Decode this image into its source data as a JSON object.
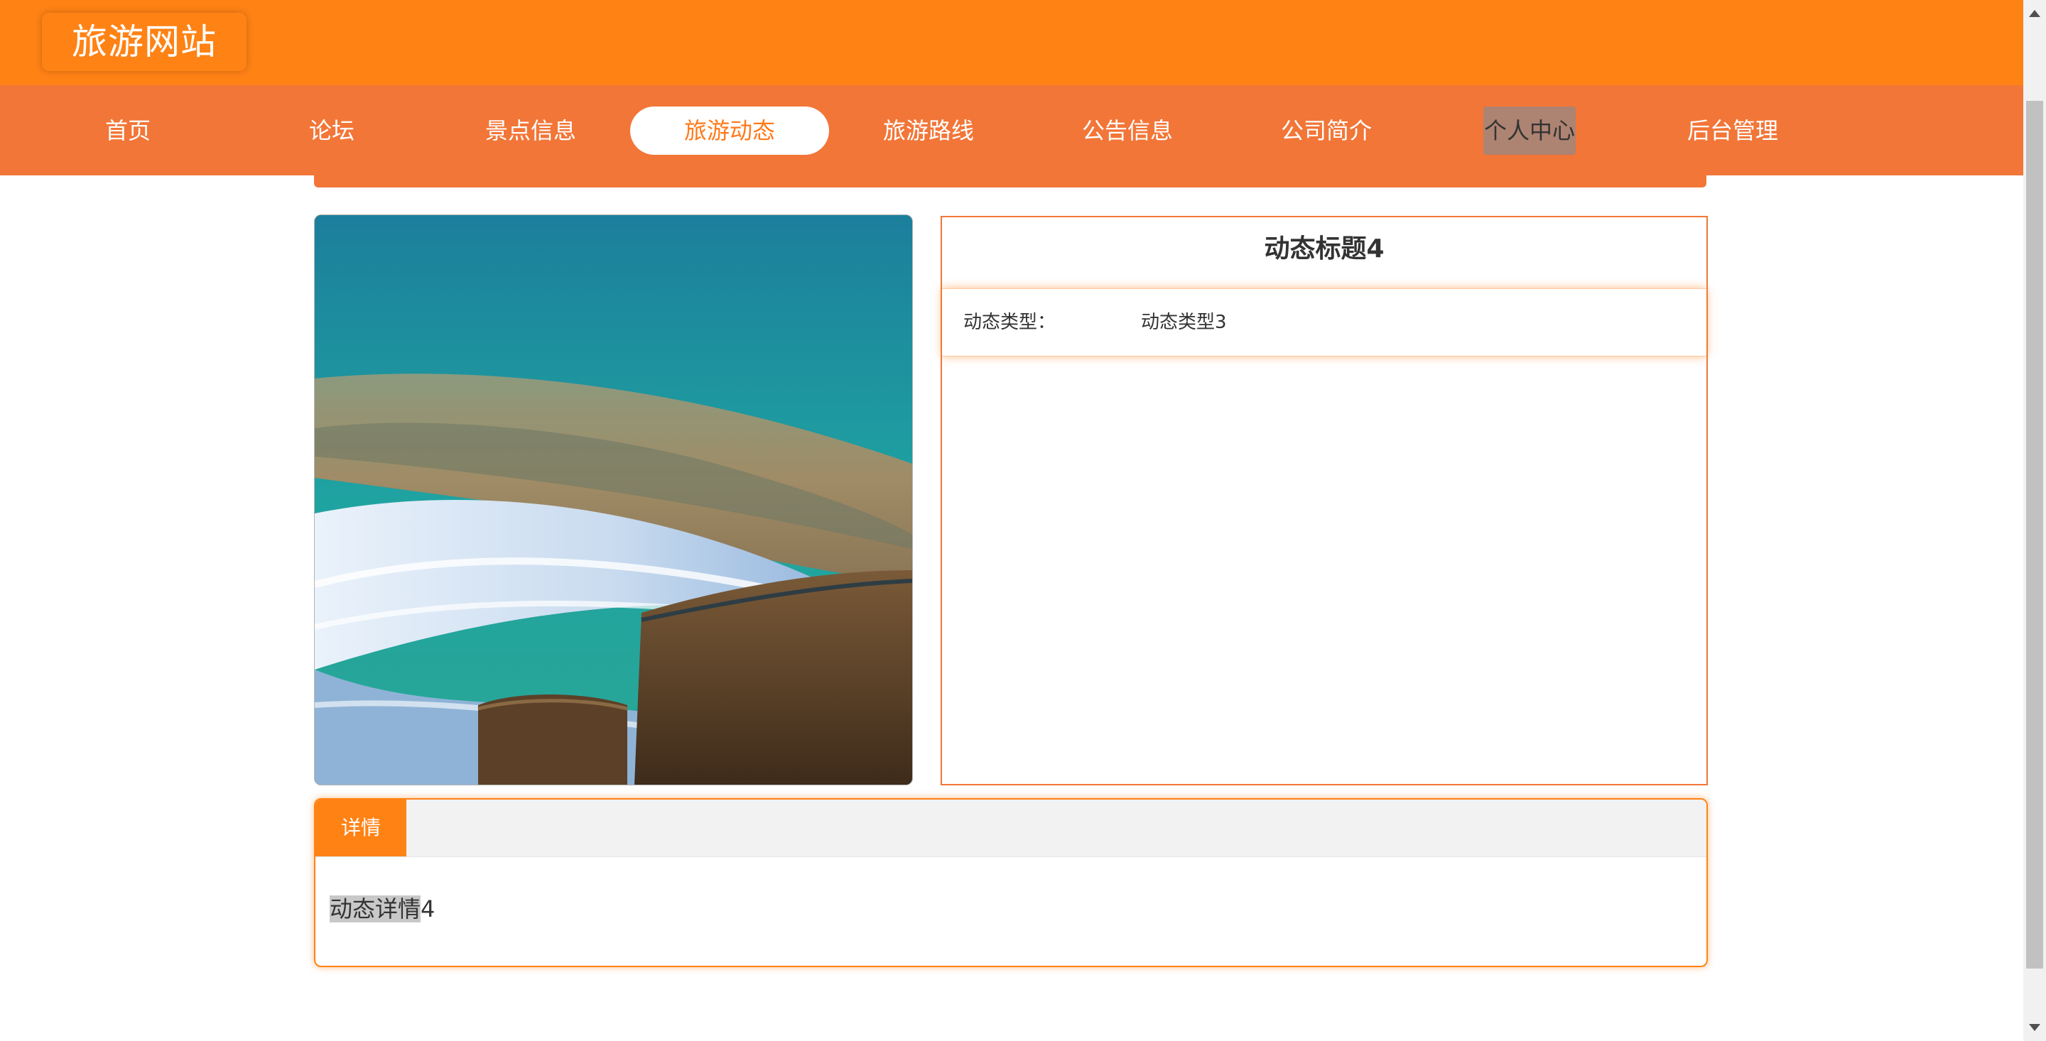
{
  "site": {
    "title": "旅游网站"
  },
  "nav": {
    "items": [
      {
        "label": "首页",
        "state": "normal"
      },
      {
        "label": "论坛",
        "state": "normal"
      },
      {
        "label": "景点信息",
        "state": "normal"
      },
      {
        "label": "旅游动态",
        "state": "active"
      },
      {
        "label": "旅游路线",
        "state": "normal"
      },
      {
        "label": "公告信息",
        "state": "normal"
      },
      {
        "label": "公司简介",
        "state": "normal"
      },
      {
        "label": "个人中心",
        "state": "hover"
      },
      {
        "label": "后台管理",
        "state": "normal"
      }
    ]
  },
  "article": {
    "image_icon": "landscape-image",
    "title": "动态标题4",
    "type_label": "动态类型：",
    "type_value": "动态类型3"
  },
  "detail": {
    "tab_label": "详情",
    "content_selected": "动态详情",
    "content_rest": "4"
  },
  "colors": {
    "header_orange": "#ff8215",
    "nav_orange": "#f27638",
    "active_text": "#ff7a1a",
    "hover_bg": "#ad8372",
    "text_dark": "#333333"
  }
}
